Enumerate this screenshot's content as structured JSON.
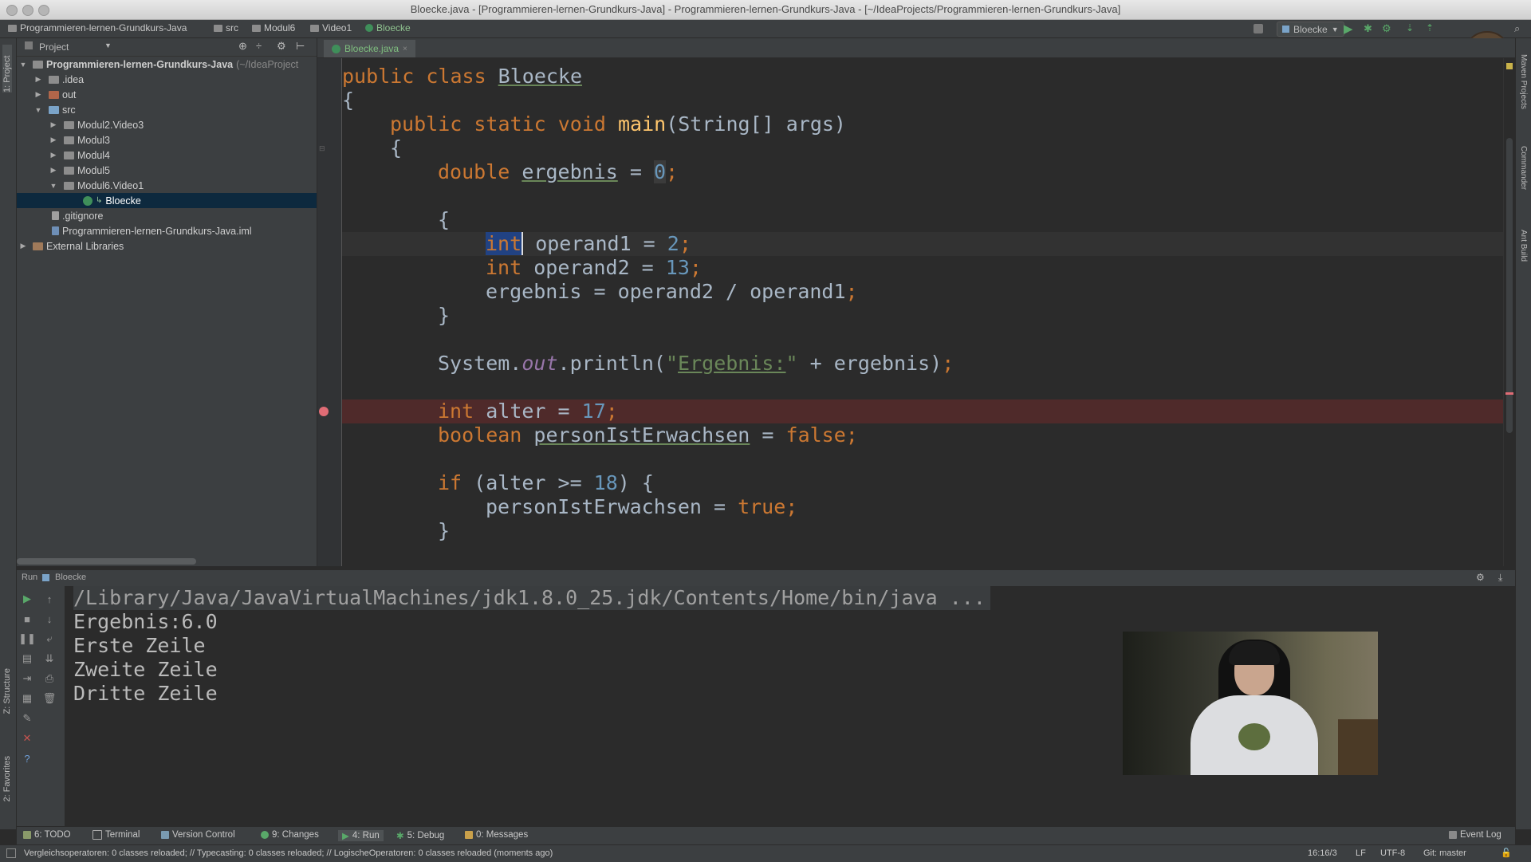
{
  "window": {
    "title": "Bloecke.java - [Programmieren-lernen-Grundkurs-Java] - Programmieren-lernen-Grundkurs-Java - [~/IdeaProjects/Programmieren-lernen-Grundkurs-Java]"
  },
  "breadcrumbs": [
    "Programmieren-lernen-Grundkurs-Java",
    "src",
    "Modul6",
    "Video1",
    "Bloecke"
  ],
  "run_config": "Bloecke",
  "left_stripe": {
    "project_label": "1: Project",
    "structure_label": "Z: Structure",
    "favorites_label": "2: Favorites"
  },
  "right_stripe": {
    "maven_label": "Maven Projects",
    "commander_label": "Commander",
    "ant_label": "Ant Build"
  },
  "project_panel": {
    "header": "Project",
    "root": {
      "name": "Programmieren-lernen-Grundkurs-Java",
      "path": "(~/IdeaProject"
    },
    "items": [
      {
        "label": ".idea"
      },
      {
        "label": "out"
      },
      {
        "label": "src"
      },
      {
        "label": "Modul2.Video3"
      },
      {
        "label": "Modul3"
      },
      {
        "label": "Modul4"
      },
      {
        "label": "Modul5"
      },
      {
        "label": "Modul6.Video1"
      },
      {
        "label": "Bloecke"
      },
      {
        "label": ".gitignore"
      },
      {
        "label": "Programmieren-lernen-Grundkurs-Java.iml"
      },
      {
        "label": "External Libraries"
      }
    ]
  },
  "editor": {
    "tab": "Bloecke.java",
    "code": {
      "l1": {
        "a": "public class ",
        "b": "Bloecke"
      },
      "l2": "{",
      "l3": {
        "a": "public static void ",
        "b": "main",
        "c": "(String[] args)"
      },
      "l4": "{",
      "l5": {
        "a": "double ",
        "b": "ergebnis",
        "c": " = ",
        "d": "0",
        "e": ";"
      },
      "l6": "{",
      "l7": {
        "a": "int",
        "b": " operand1 = ",
        "c": "2",
        "d": ";"
      },
      "l8": {
        "a": "int ",
        "b": "operand2 = ",
        "c": "13",
        "d": ";"
      },
      "l9": {
        "a": "ergebnis = operand2 / operand1",
        "b": ";"
      },
      "l10": "}",
      "l11": {
        "a": "System.",
        "b": "out",
        "c": ".println(",
        "d": "\"",
        "e": "Ergebnis:",
        "f": "\"",
        "g": " + ergebnis)",
        "h": ";"
      },
      "l12": {
        "a": "int ",
        "b": "alter = ",
        "c": "17",
        "d": ";"
      },
      "l13": {
        "a": "boolean ",
        "b": "personIstErwachsen",
        "c": " = ",
        "d": "false",
        "e": ";"
      },
      "l14": {
        "a": "if ",
        "b": "(alter >= ",
        "c": "18",
        "d": ") {"
      },
      "l15": {
        "a": "personIstErwachsen = ",
        "b": "true",
        "c": ";"
      },
      "l16": "}"
    }
  },
  "run_panel": {
    "header_run": "Run",
    "header_config": "Bloecke",
    "console": [
      "/Library/Java/JavaVirtualMachines/jdk1.8.0_25.jdk/Contents/Home/bin/java ...",
      "Ergebnis:6.0",
      "Erste Zeile",
      "Zweite Zeile",
      "Dritte Zeile"
    ]
  },
  "tool_windows": {
    "todo": "6: TODO",
    "terminal": "Terminal",
    "vcs": "Version Control",
    "changes": "9: Changes",
    "run": "4: Run",
    "debug": "5: Debug",
    "messages": "0: Messages",
    "event_log": "Event Log"
  },
  "status": {
    "message": "Vergleichsoperatoren: 0 classes reloaded; // Typecasting: 0 classes reloaded; // LogischeOperatoren: 0 classes reloaded (moments ago)",
    "position": "16:16/3",
    "line_sep": "LF",
    "encoding": "UTF-8",
    "git": "Git: master"
  },
  "colors": {
    "keyword": "#cc7832",
    "number": "#6897bb",
    "method": "#ffc66d",
    "string": "#6a8759",
    "breakpoint": "#e06c75"
  }
}
